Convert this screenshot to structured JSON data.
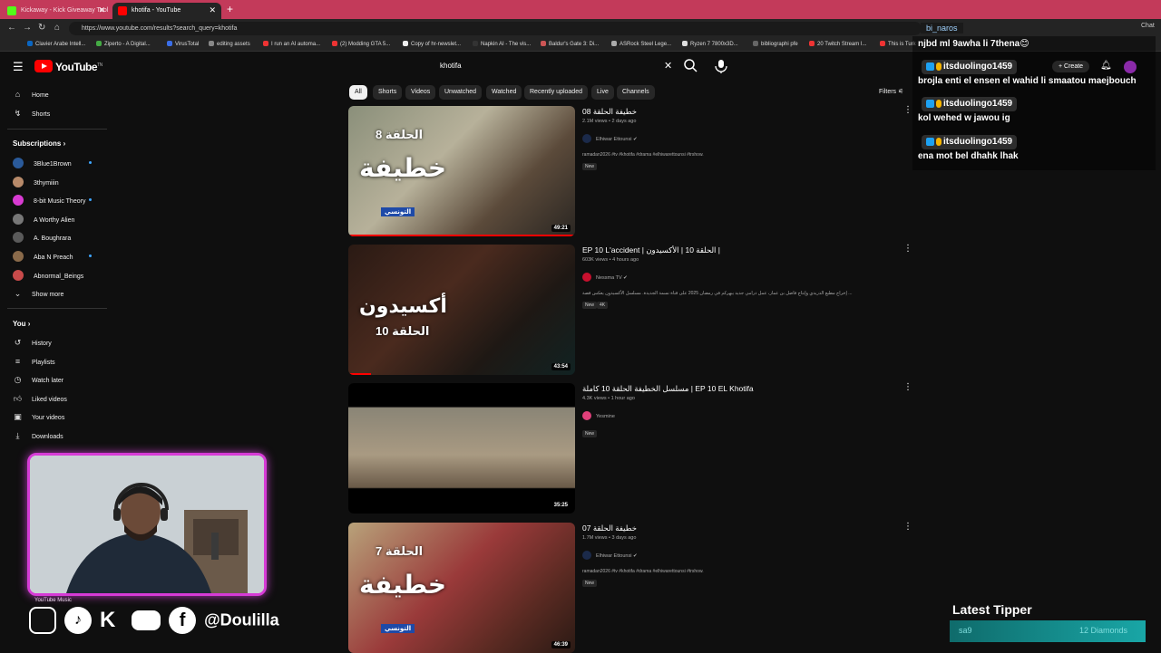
{
  "browser": {
    "tabs": [
      {
        "label": "Kickaway - Kick Giveaway Tool",
        "fav_color": "#53fc18"
      },
      {
        "label": "khotifa - YouTube",
        "fav_color": "#ff0000"
      }
    ],
    "url": "https://www.youtube.com/results?search_query=khotifa",
    "bookmarks": [
      "Clavier Arabe Intell...",
      "Ziperto - A Digital...",
      "VirusTotal",
      "editing assets",
      "I run an AI automa...",
      "(2) Modding GTA 5...",
      "Copy of hr-newslet...",
      "Napkin AI - The vis...",
      "Baldur's Gate 3: Di...",
      "ASRock Steel Lege...",
      "Ryzen 7 7800x3D...",
      "bibliographi pfe",
      "20 Twitch Stream I...",
      "This is Turk"
    ],
    "chat_label": "Chat"
  },
  "youtube": {
    "logo": "YouTube",
    "logo_country": "TN",
    "search_query": "khotifa",
    "chips": [
      "All",
      "Shorts",
      "Videos",
      "Unwatched",
      "Watched",
      "Recently uploaded",
      "Live",
      "Channels"
    ],
    "filters_label": "Filters",
    "create_label": "Create",
    "sidebar": {
      "home": "Home",
      "shorts": "Shorts",
      "subscriptions_label": "Subscriptions",
      "subscriptions": [
        {
          "name": "3Blue1Brown",
          "color": "#2a5a9a",
          "dot": true
        },
        {
          "name": "3thymiiin",
          "color": "#b78a6a",
          "dot": false
        },
        {
          "name": "8-bit Music Theory",
          "color": "#d83bd2",
          "dot": true
        },
        {
          "name": "A Worthy Alien",
          "color": "#777777",
          "dot": false
        },
        {
          "name": "A. Boughrara",
          "color": "#5a5a5a",
          "dot": false
        },
        {
          "name": "Aba N Preach",
          "color": "#8a6a4a",
          "dot": true
        },
        {
          "name": "Abnormal_Beings",
          "color": "#c84a4a",
          "dot": false
        }
      ],
      "show_more": "Show more",
      "you_label": "You",
      "you_items": [
        "History",
        "Playlists",
        "Watch later",
        "Liked videos",
        "Your videos",
        "Downloads"
      ],
      "youtube_music": "YouTube Music"
    },
    "videos": [
      {
        "title": "خطيفة الحلقة 08",
        "meta": "2.1M views • 2 days ago",
        "channel": "Elhiwar Ettounsi",
        "verified": true,
        "channel_color": "#1b2a4a",
        "desc": "ramadan2026 #tv #khotifa #drama #elhiwarettounsi #trshow.",
        "badges": [
          "New"
        ],
        "duration": "49:21",
        "progress": 1.0,
        "thumb_caption": "الحلقة 8",
        "thumb_logo": "خطيفة"
      },
      {
        "title": "EP 10 L'accident | الحلقة 10 | الأكسيدون |",
        "meta": "603K views • 4 hours ago",
        "channel": "Nessma TV",
        "verified": true,
        "channel_color": "#c8102e",
        "desc": "إخراج مطيع الدريدي وإنتاج فاضل بن عمار، عمل درامي جديد يبهركم في رمضان 2025 على قناة نسمة الجديدة. مسلسل الأكسيدون يعكس قصة ...",
        "badges": [
          "New",
          "4K"
        ],
        "duration": "43:54",
        "progress": 0.1,
        "thumb_caption": "الحلقة 10",
        "thumb_logo": "أكسيدون"
      },
      {
        "title": "مسلسل الخطيفة الحلقة 10 كاملة | EP 10 EL Khotifa",
        "meta": "4.3K views • 1 hour ago",
        "channel": "Yesmine",
        "verified": false,
        "channel_color": "#e0407a",
        "desc": "",
        "badges": [
          "New"
        ],
        "duration": "35:25",
        "progress": 0,
        "thumb_caption": "",
        "thumb_logo": ""
      },
      {
        "title": "خطيفة الحلقة 07",
        "meta": "1.7M views • 3 days ago",
        "channel": "Elhiwar Ettounsi",
        "verified": true,
        "channel_color": "#1b2a4a",
        "desc": "ramadan2026 #tv #khotifa #drama #elhiwarettounsi #trshow.",
        "badges": [
          "New"
        ],
        "duration": "46:39",
        "progress": 0,
        "thumb_caption": "الحلقة 7",
        "thumb_logo": "خطيفة"
      }
    ],
    "channel_tag": "التونسي"
  },
  "stream": {
    "top_user": "bi_naros",
    "first_message": "njbd ml 9awha li 7thena😊",
    "chat": [
      {
        "user": "itsduolingo1459",
        "message": "brojla enti el ensen el wahid li smaatou maejbouch"
      },
      {
        "user": "itsduolingo1459",
        "message": "kol wehed w jawou ig"
      },
      {
        "user": "itsduolingo1459",
        "message": "ena mot bel dhahk lhak"
      }
    ],
    "handle": "@Doulilla",
    "latest_tipper_label": "Latest Tipper",
    "latest_tipper_name": "sa9",
    "latest_tipper_amount": "12 Diamonds"
  }
}
